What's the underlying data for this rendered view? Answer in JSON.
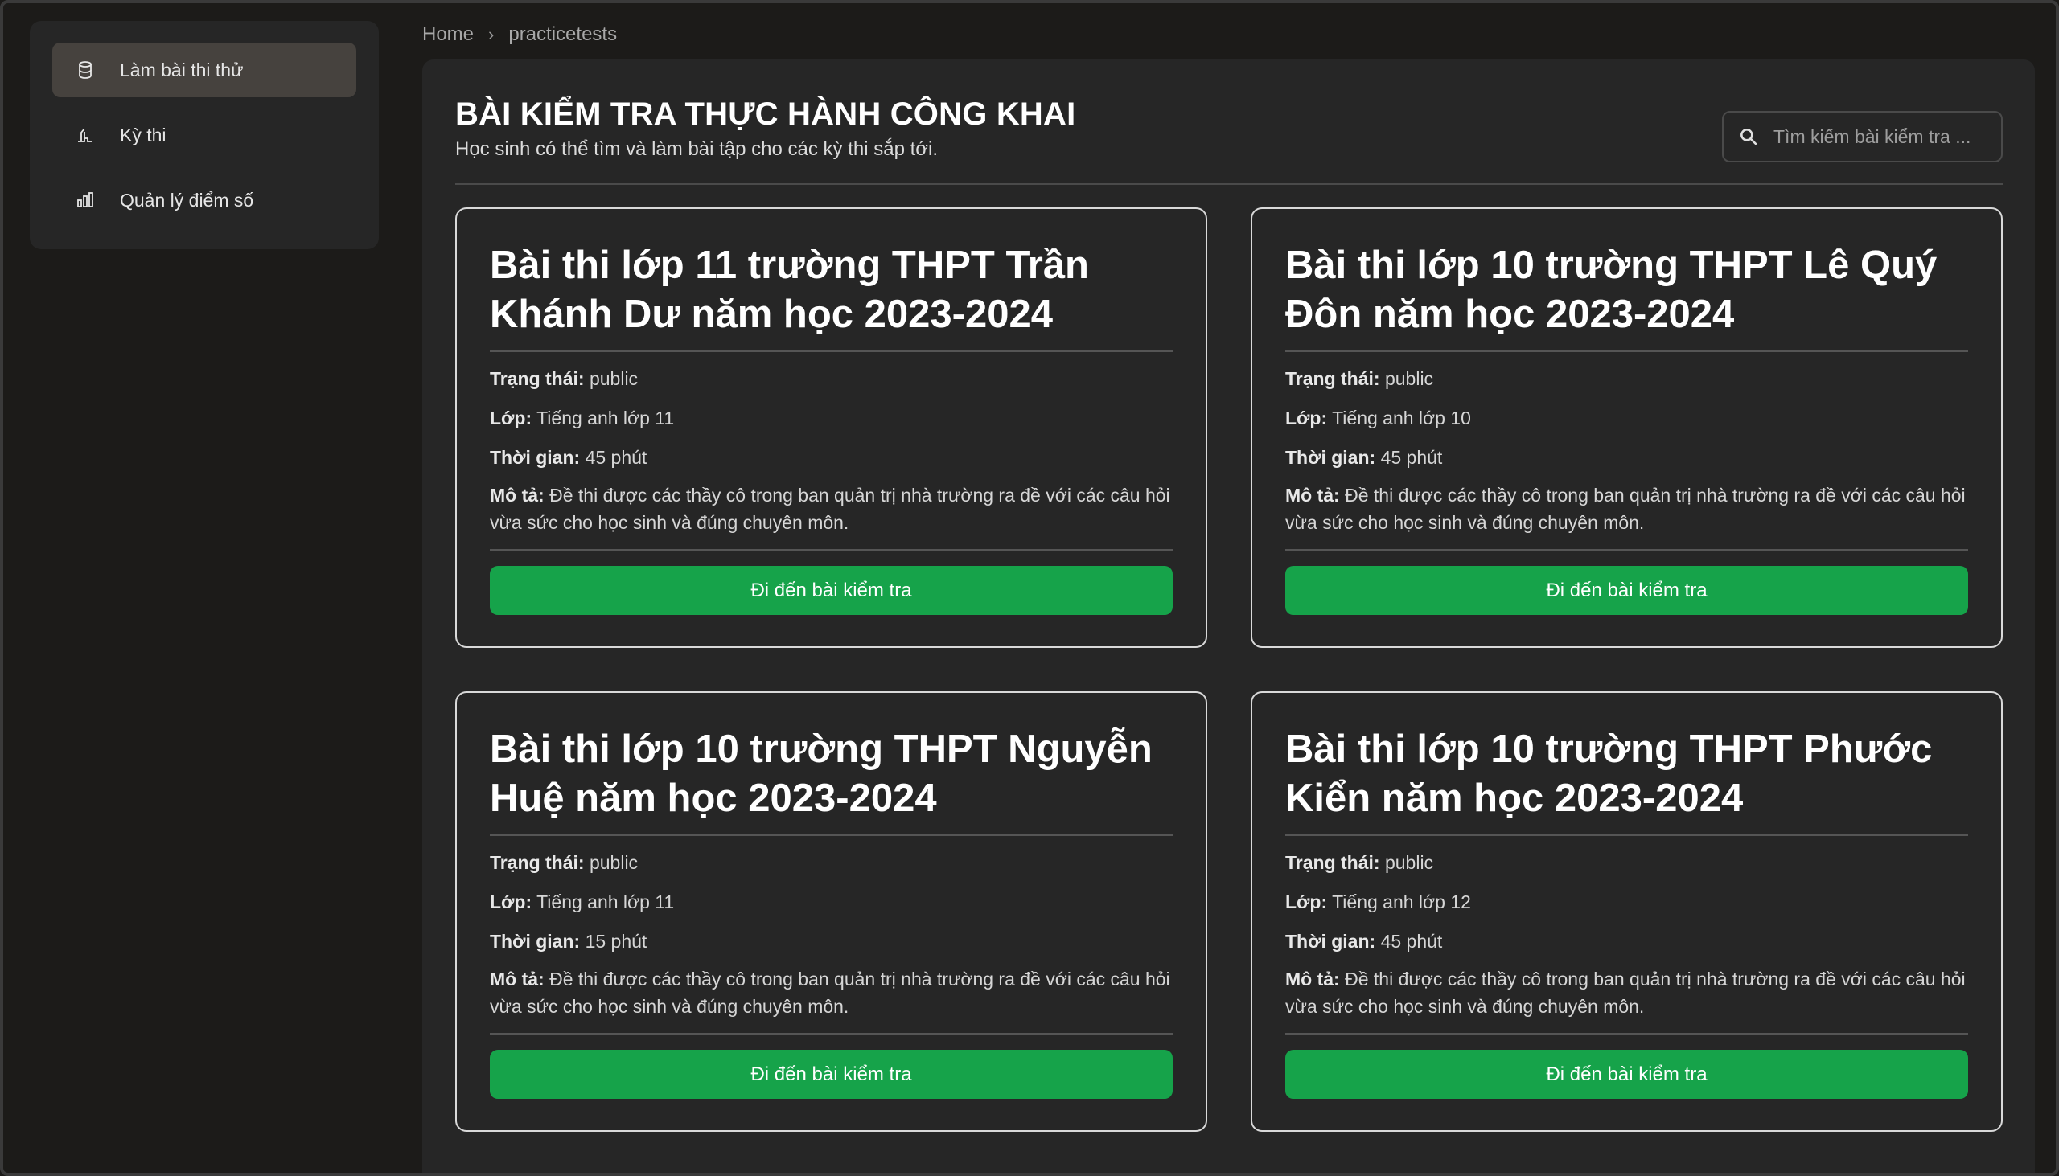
{
  "sidebar": {
    "items": [
      {
        "label": "Làm bài thi thử",
        "icon": "database-icon",
        "active": true
      },
      {
        "label": "Kỳ thi",
        "icon": "exam-icon",
        "active": false
      },
      {
        "label": "Quản lý điểm số",
        "icon": "bar-chart-icon",
        "active": false
      }
    ]
  },
  "breadcrumb": {
    "home": "Home",
    "separator": "›",
    "current": "practicetests"
  },
  "header": {
    "title": "BÀI KIỂM TRA THỰC HÀNH CÔNG KHAI",
    "subtitle": "Học sinh có thể tìm và làm bài tập cho các kỳ thi sắp tới."
  },
  "search": {
    "placeholder": "Tìm kiếm bài kiểm tra ...",
    "value": ""
  },
  "labels": {
    "status": "Trạng thái:",
    "class": "Lớp:",
    "time": "Thời gian:",
    "description": "Mô tả:"
  },
  "tests": [
    {
      "title": "Bài thi lớp 11 trường THPT Trần Khánh Dư năm học 2023-2024",
      "status": "public",
      "class": "Tiếng anh lớp 11",
      "time": "45 phút",
      "description": "Đề thi được các thầy cô trong ban quản trị nhà trường ra đề với các câu hỏi vừa sức cho học sinh và đúng chuyên môn.",
      "button": "Đi đến bài kiểm tra"
    },
    {
      "title": "Bài thi lớp 10 trường THPT Lê Quý Đôn năm học 2023-2024",
      "status": "public",
      "class": "Tiếng anh lớp 10",
      "time": "45 phút",
      "description": "Đề thi được các thầy cô trong ban quản trị nhà trường ra đề với các câu hỏi vừa sức cho học sinh và đúng chuyên môn.",
      "button": "Đi đến bài kiểm tra"
    },
    {
      "title": "Bài thi lớp 10 trường THPT Nguyễn Huệ năm học 2023-2024",
      "status": "public",
      "class": "Tiếng anh lớp 11",
      "time": "15 phút",
      "description": "Đề thi được các thầy cô trong ban quản trị nhà trường ra đề với các câu hỏi vừa sức cho học sinh và đúng chuyên môn.",
      "button": "Đi đến bài kiểm tra"
    },
    {
      "title": "Bài thi lớp 10 trường THPT Phước Kiển năm học 2023-2024",
      "status": "public",
      "class": "Tiếng anh lớp 12",
      "time": "45 phút",
      "description": "Đề thi được các thầy cô trong ban quản trị nhà trường ra đề với các câu hỏi vừa sức cho học sinh và đúng chuyên môn.",
      "button": "Đi đến bài kiểm tra"
    }
  ],
  "colors": {
    "accent": "#16a34a",
    "background": "#1c1b19",
    "panel": "#262626",
    "active_nav": "#46423e"
  }
}
